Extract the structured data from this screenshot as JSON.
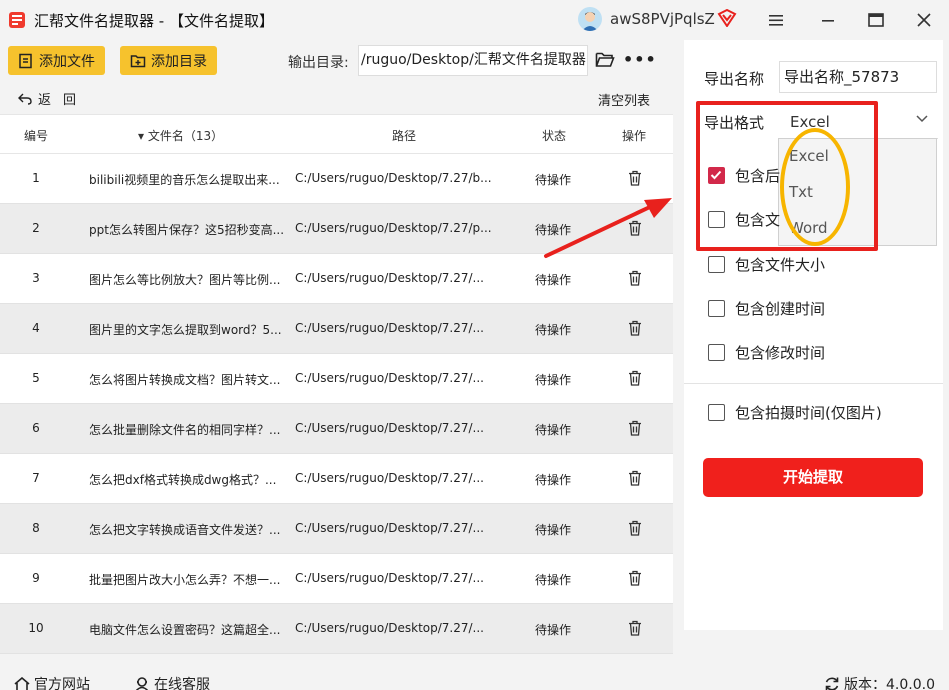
{
  "titlebar": {
    "app_title": "汇帮文件名提取器 - 【文件名提取】",
    "username": "awS8PVjPqlsZ"
  },
  "toolbar": {
    "add_file_label": "添加文件",
    "add_dir_label": "添加目录",
    "output_label": "输出目录:",
    "output_path": "/ruguo/Desktop/汇帮文件名提取器",
    "more_label": "•••",
    "back_label": "返回",
    "clear_label": "清空列表"
  },
  "table": {
    "headers": {
      "no": "编号",
      "name": "▾ 文件名（13）",
      "path": "路径",
      "status": "状态",
      "action": "操作"
    },
    "rows": [
      {
        "no": "1",
        "name": "bilibili视频里的音乐怎么提取出来...",
        "path": "C:/Users/ruguo/Desktop/7.27/b...",
        "status": "待操作"
      },
      {
        "no": "2",
        "name": "ppt怎么转图片保存？这5招秒变高...",
        "path": "C:/Users/ruguo/Desktop/7.27/p...",
        "status": "待操作"
      },
      {
        "no": "3",
        "name": "图片怎么等比例放大？图片等比例...",
        "path": "C:/Users/ruguo/Desktop/7.27/...",
        "status": "待操作"
      },
      {
        "no": "4",
        "name": "图片里的文字怎么提取到word？5...",
        "path": "C:/Users/ruguo/Desktop/7.27/...",
        "status": "待操作"
      },
      {
        "no": "5",
        "name": "怎么将图片转换成文档？图片转文...",
        "path": "C:/Users/ruguo/Desktop/7.27/...",
        "status": "待操作"
      },
      {
        "no": "6",
        "name": "怎么批量删除文件名的相同字样？...",
        "path": "C:/Users/ruguo/Desktop/7.27/...",
        "status": "待操作"
      },
      {
        "no": "7",
        "name": "怎么把dxf格式转换成dwg格式？...",
        "path": "C:/Users/ruguo/Desktop/7.27/...",
        "status": "待操作"
      },
      {
        "no": "8",
        "name": "怎么把文字转换成语音文件发送？...",
        "path": "C:/Users/ruguo/Desktop/7.27/...",
        "status": "待操作"
      },
      {
        "no": "9",
        "name": "批量把图片改大小怎么弄？不想一...",
        "path": "C:/Users/ruguo/Desktop/7.27/...",
        "status": "待操作"
      },
      {
        "no": "10",
        "name": "电脑文件怎么设置密码？这篇超全...",
        "path": "C:/Users/ruguo/Desktop/7.27/...",
        "status": "待操作"
      }
    ]
  },
  "panel": {
    "export_name_label": "导出名称",
    "export_name_value": "导出名称_57873",
    "export_format_label": "导出格式",
    "export_format_value": "Excel",
    "format_options": [
      "Excel",
      "Txt",
      "Word"
    ],
    "opt_suffix": "包含后",
    "opt_file": "包含文",
    "opt_size": "包含文件大小",
    "opt_created": "包含创建时间",
    "opt_modified": "包含修改时间",
    "opt_shot": "包含拍摄时间(仅图片)",
    "start_label": "开始提取"
  },
  "footer": {
    "website_label": "官方网站",
    "service_label": "在线客服",
    "version_label": "版本：4.0.0.0"
  },
  "colors": {
    "accent_yellow": "#f6c22d",
    "start_red": "#f0201c",
    "checkbox_checked": "#d2294a",
    "annotation_red": "#e8211d",
    "annotation_yellow": "#f7b500"
  }
}
